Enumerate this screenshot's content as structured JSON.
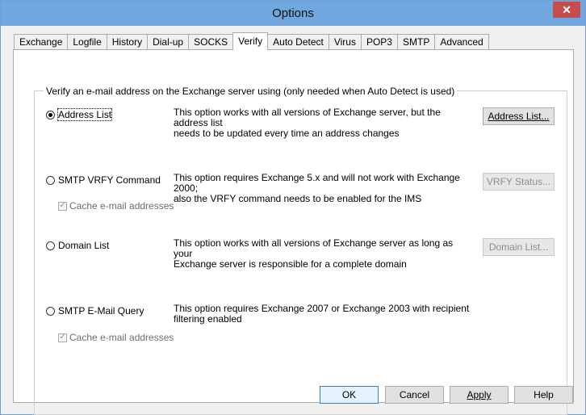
{
  "window": {
    "title": "Options",
    "close_glyph": "✕"
  },
  "tabs": [
    {
      "label": "Exchange"
    },
    {
      "label": "Logfile"
    },
    {
      "label": "History"
    },
    {
      "label": "Dial-up"
    },
    {
      "label": "SOCKS"
    },
    {
      "label": "Verify",
      "active": true
    },
    {
      "label": "Auto Detect"
    },
    {
      "label": "Virus"
    },
    {
      "label": "POP3"
    },
    {
      "label": "SMTP"
    },
    {
      "label": "Advanced"
    }
  ],
  "group": {
    "label": "Verify an e-mail address on the Exchange server using (only needed when Auto Detect is used)"
  },
  "options": {
    "address_list": {
      "label": "Address List",
      "selected": true,
      "desc1": "This option works with all versions of Exchange server, but the address list",
      "desc2": "needs to be updated every time an address changes",
      "button": "Address List..."
    },
    "smtp_vrfy": {
      "label": "SMTP VRFY Command",
      "desc1": "This option requires Exchange 5.x and will not work with Exchange 2000;",
      "desc2": "also the VRFY command needs to be enabled for the IMS",
      "button": "VRFY Status...",
      "cache_label": "Cache e-mail addresses"
    },
    "domain_list": {
      "label": "Domain List",
      "desc1": "This option works with all versions of Exchange server as long as your",
      "desc2": "Exchange server is responsible for a complete domain",
      "button": "Domain List..."
    },
    "smtp_query": {
      "label": "SMTP E-Mail Query",
      "desc1": "This option requires Exchange 2007 or Exchange 2003 with recipient",
      "desc2": "filtering enabled",
      "cache_label": "Cache e-mail addresses"
    }
  },
  "footer": {
    "ok": "OK",
    "cancel": "Cancel",
    "apply": "Apply",
    "help": "Help"
  },
  "icons": {
    "check": "✓"
  }
}
